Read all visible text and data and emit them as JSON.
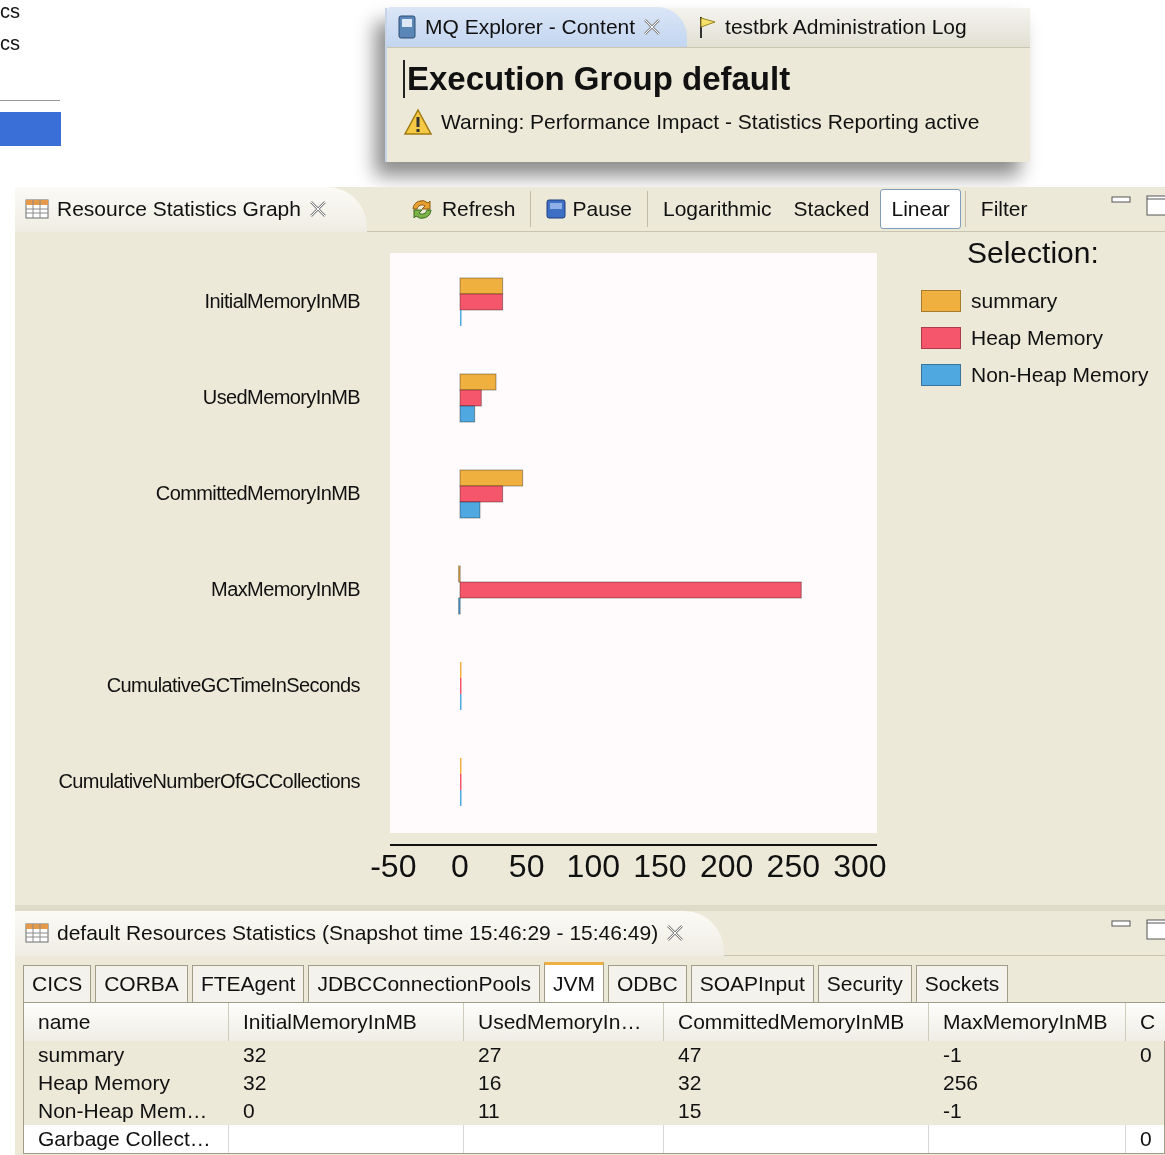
{
  "background_fragment": {
    "lines": [
      "cs",
      "cs"
    ]
  },
  "explorer_window": {
    "tabs": [
      {
        "label": "MQ Explorer - Content",
        "closable": true,
        "selected": true
      },
      {
        "label": "testbrk  Administration Log",
        "closable": false,
        "selected": false
      }
    ],
    "heading": "Execution Group default",
    "warning": "Warning: Performance Impact - Statistics Reporting active"
  },
  "graph_view": {
    "title": "Resource Statistics Graph",
    "toolbar": [
      {
        "label": "Refresh",
        "selected": false,
        "separator_after": true
      },
      {
        "label": "Pause",
        "selected": false,
        "separator_after": true
      },
      {
        "label": "Logarithmic",
        "selected": false,
        "separator_after": false
      },
      {
        "label": "Stacked",
        "selected": false,
        "separator_after": false
      },
      {
        "label": "Linear",
        "selected": true,
        "separator_after": true
      },
      {
        "label": "Filter",
        "selected": false,
        "separator_after": false
      }
    ],
    "chart_data": {
      "type": "bar",
      "orientation": "horizontal",
      "legend": {
        "title": "Selection:"
      },
      "categories": [
        "InitialMemoryInMB",
        "UsedMemoryInMB",
        "CommittedMemoryInMB",
        "MaxMemoryInMB",
        "CumulativeGCTimeInSeconds",
        "CumulativeNumberOfGCCollections"
      ],
      "series": [
        {
          "name": "summary",
          "color": "#f0b040",
          "values": [
            32,
            27,
            47,
            -1,
            0,
            0
          ]
        },
        {
          "name": "Heap Memory",
          "color": "#f5566c",
          "values": [
            32,
            16,
            32,
            256,
            0,
            0
          ]
        },
        {
          "name": "Non-Heap Memory",
          "color": "#50a8e0",
          "values": [
            0,
            11,
            15,
            -1,
            0,
            0
          ]
        }
      ],
      "xlim": [
        -52.5,
        312.8
      ],
      "xticks": [
        -50,
        0,
        50,
        100,
        150,
        200,
        250,
        300
      ]
    }
  },
  "statistics_view": {
    "title": "default Resources Statistics (Snapshot time 15:46:29 - 15:46:49)",
    "tabs": [
      {
        "label": "CICS",
        "selected": false
      },
      {
        "label": "CORBA",
        "selected": false
      },
      {
        "label": "FTEAgent",
        "selected": false
      },
      {
        "label": "JDBCConnectionPools",
        "selected": false
      },
      {
        "label": "JVM",
        "selected": true
      },
      {
        "label": "ODBC",
        "selected": false
      },
      {
        "label": "SOAPInput",
        "selected": false
      },
      {
        "label": "Security",
        "selected": false
      },
      {
        "label": "Sockets",
        "selected": false
      }
    ],
    "columns": [
      "name",
      "InitialMemoryInMB",
      "UsedMemoryIn…",
      "CommittedMemoryInMB",
      "MaxMemoryInMB",
      "C"
    ],
    "rows": [
      {
        "selected": true,
        "cells": [
          "summary",
          "32",
          "27",
          "47",
          "-1",
          "0"
        ]
      },
      {
        "selected": true,
        "cells": [
          "Heap Memory",
          "32",
          "16",
          "32",
          "256",
          ""
        ]
      },
      {
        "selected": true,
        "cells": [
          "Non-Heap Mem…",
          "0",
          "11",
          "15",
          "-1",
          ""
        ]
      },
      {
        "selected": false,
        "cells": [
          "Garbage Collect…",
          "",
          "",
          "",
          "",
          "0"
        ]
      }
    ]
  }
}
